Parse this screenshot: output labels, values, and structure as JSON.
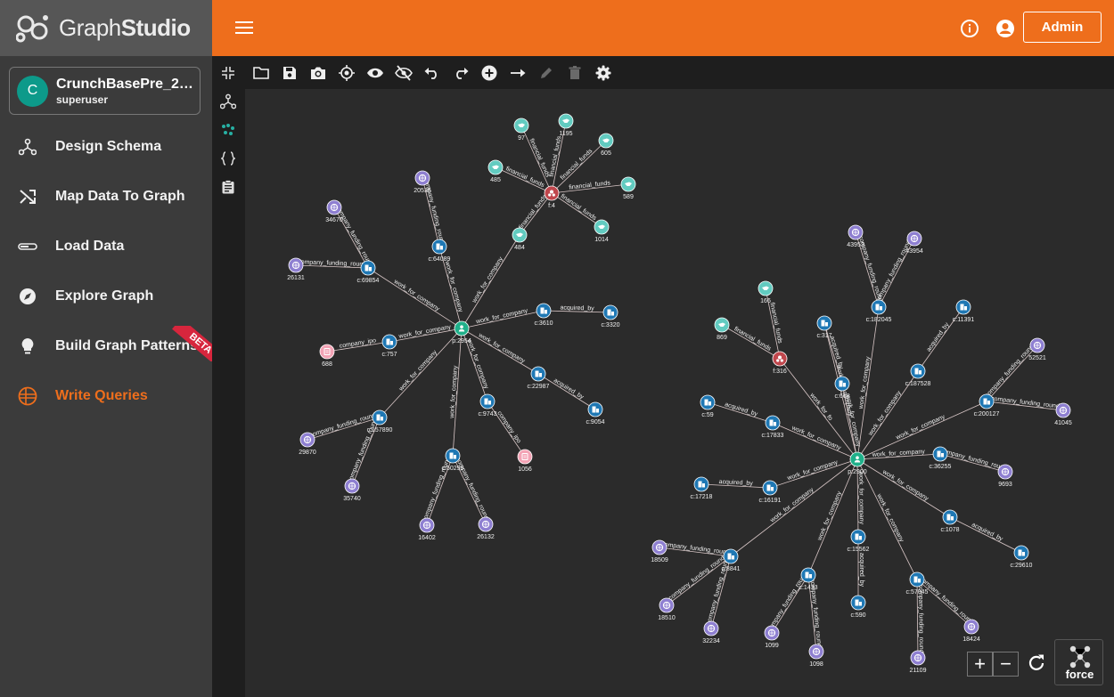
{
  "app": {
    "logo_regular": "Graph",
    "logo_bold": "Studio"
  },
  "graph_card": {
    "avatar_letter": "C",
    "name": "CrunchBasePre_20...",
    "role": "superuser"
  },
  "nav": [
    {
      "label": "Design Schema",
      "icon": "schema-icon"
    },
    {
      "label": "Map Data To Graph",
      "icon": "shuffle-icon"
    },
    {
      "label": "Load Data",
      "icon": "load-bar-icon"
    },
    {
      "label": "Explore Graph",
      "icon": "compass-icon"
    },
    {
      "label": "Build Graph Patterns",
      "icon": "lightbulb-icon",
      "badge": "BETA"
    },
    {
      "label": "Write Queries",
      "icon": "queries-icon",
      "active": true
    }
  ],
  "header": {
    "admin_label": "Admin"
  },
  "controls": {
    "zoom_in": "+",
    "zoom_out": "−",
    "layout_label": "force"
  },
  "colors": {
    "accent": "#ee6e1c",
    "person": "#20b08a",
    "company": "#1f78b4",
    "funding": "#8e7fd1",
    "investor": "#62cbc0",
    "ipo": "#f3a3b5",
    "financial_org": "#c0474d",
    "beta": "#d7263d"
  },
  "graph": {
    "nodes": [
      {
        "id": "p:2954",
        "label": "p:2954",
        "kind": "person"
      },
      {
        "id": "c:64089",
        "label": "c:64089",
        "kind": "company"
      },
      {
        "id": "c:69854",
        "label": "c:69854",
        "kind": "company"
      },
      {
        "id": "c:3610",
        "label": "c:3610",
        "kind": "company"
      },
      {
        "id": "c:3320",
        "label": "c:3320",
        "kind": "company"
      },
      {
        "id": "c:757",
        "label": "c:757",
        "kind": "company"
      },
      {
        "id": "c:22987",
        "label": "c:22987",
        "kind": "company"
      },
      {
        "id": "c:9054",
        "label": "c:9054",
        "kind": "company"
      },
      {
        "id": "c:9743",
        "label": "c:9743",
        "kind": "company"
      },
      {
        "id": "c:157890",
        "label": "c:157890",
        "kind": "company"
      },
      {
        "id": "c:50295",
        "label": "c:50295",
        "kind": "company"
      },
      {
        "id": "r:20535",
        "label": "20535",
        "kind": "funding"
      },
      {
        "id": "r:34670",
        "label": "34670",
        "kind": "funding"
      },
      {
        "id": "r:26131",
        "label": "26131",
        "kind": "funding"
      },
      {
        "id": "r:29870",
        "label": "29870",
        "kind": "funding"
      },
      {
        "id": "r:35740",
        "label": "35740",
        "kind": "funding"
      },
      {
        "id": "r:16402",
        "label": "16402",
        "kind": "funding"
      },
      {
        "id": "r:26132",
        "label": "26132",
        "kind": "funding"
      },
      {
        "id": "i:688",
        "label": "688",
        "kind": "ipo"
      },
      {
        "id": "i:1056",
        "label": "1056",
        "kind": "ipo"
      },
      {
        "id": "f:4",
        "label": "f:4",
        "kind": "financial_org"
      },
      {
        "id": "v:97",
        "label": "97",
        "kind": "investor"
      },
      {
        "id": "v:1195",
        "label": "1195",
        "kind": "investor"
      },
      {
        "id": "v:605",
        "label": "605",
        "kind": "investor"
      },
      {
        "id": "v:485",
        "label": "485",
        "kind": "investor"
      },
      {
        "id": "v:589",
        "label": "589",
        "kind": "investor"
      },
      {
        "id": "v:1014",
        "label": "1014",
        "kind": "investor"
      },
      {
        "id": "v:484",
        "label": "484",
        "kind": "investor"
      },
      {
        "id": "p:2900",
        "label": "p:2900",
        "kind": "person"
      },
      {
        "id": "f:316",
        "label": "f:316",
        "kind": "financial_org"
      },
      {
        "id": "v:166",
        "label": "166",
        "kind": "investor"
      },
      {
        "id": "v:869",
        "label": "869",
        "kind": "investor"
      },
      {
        "id": "c:317",
        "label": "c:317",
        "kind": "company"
      },
      {
        "id": "c:182045",
        "label": "c:182045",
        "kind": "company"
      },
      {
        "id": "r:43953",
        "label": "43953",
        "kind": "funding"
      },
      {
        "id": "r:43954",
        "label": "43954",
        "kind": "funding"
      },
      {
        "id": "c:11391",
        "label": "c:11391",
        "kind": "company"
      },
      {
        "id": "c:187528",
        "label": "c:187528",
        "kind": "company"
      },
      {
        "id": "c:668",
        "label": "c:668",
        "kind": "company"
      },
      {
        "id": "r:52521",
        "label": "52521",
        "kind": "funding"
      },
      {
        "id": "c:200127",
        "label": "c:200127",
        "kind": "company"
      },
      {
        "id": "r:41045",
        "label": "41045",
        "kind": "funding"
      },
      {
        "id": "c:59",
        "label": "c:59",
        "kind": "company"
      },
      {
        "id": "c:17833",
        "label": "c:17833",
        "kind": "company"
      },
      {
        "id": "c:36255",
        "label": "c:36255",
        "kind": "company"
      },
      {
        "id": "r:9693",
        "label": "9693",
        "kind": "funding"
      },
      {
        "id": "c:17218",
        "label": "c:17218",
        "kind": "company"
      },
      {
        "id": "c:16191",
        "label": "c:16191",
        "kind": "company"
      },
      {
        "id": "c:1078",
        "label": "c:1078",
        "kind": "company"
      },
      {
        "id": "c:29610",
        "label": "c:29610",
        "kind": "company"
      },
      {
        "id": "c:15562",
        "label": "c:15562",
        "kind": "company"
      },
      {
        "id": "r:18509",
        "label": "18509",
        "kind": "funding"
      },
      {
        "id": "c:8841",
        "label": "c:8841",
        "kind": "company"
      },
      {
        "id": "r:18510",
        "label": "18510",
        "kind": "funding"
      },
      {
        "id": "r:32234",
        "label": "32234",
        "kind": "funding"
      },
      {
        "id": "c:1433",
        "label": "c:1433",
        "kind": "company"
      },
      {
        "id": "r:1099",
        "label": "1099",
        "kind": "funding"
      },
      {
        "id": "r:1098",
        "label": "1098",
        "kind": "funding"
      },
      {
        "id": "c:590",
        "label": "c:590",
        "kind": "company"
      },
      {
        "id": "c:57045",
        "label": "c:57045",
        "kind": "company"
      },
      {
        "id": "r:18424",
        "label": "18424",
        "kind": "funding"
      },
      {
        "id": "r:21109",
        "label": "21109",
        "kind": "funding"
      }
    ],
    "edges": [
      {
        "from": "p:2954",
        "to": "c:64089",
        "label": "work_for_company"
      },
      {
        "from": "p:2954",
        "to": "c:69854",
        "label": "work_for_company"
      },
      {
        "from": "p:2954",
        "to": "c:3610",
        "label": "work_for_company"
      },
      {
        "from": "p:2954",
        "to": "c:757",
        "label": "work_for_company"
      },
      {
        "from": "p:2954",
        "to": "c:22987",
        "label": "work_for_company"
      },
      {
        "from": "p:2954",
        "to": "c:9743",
        "label": "work_for_company"
      },
      {
        "from": "p:2954",
        "to": "c:157890",
        "label": "work_for_company"
      },
      {
        "from": "p:2954",
        "to": "c:50295",
        "label": "work_for_company"
      },
      {
        "from": "p:2954",
        "to": "v:484",
        "label": "work_for_company"
      },
      {
        "from": "c:3610",
        "to": "c:3320",
        "label": "acquired_by"
      },
      {
        "from": "c:22987",
        "to": "c:9054",
        "label": "acquired_by"
      },
      {
        "from": "c:64089",
        "to": "r:20535",
        "label": "company_funding_round"
      },
      {
        "from": "c:69854",
        "to": "r:34670",
        "label": "company_funding_round"
      },
      {
        "from": "c:69854",
        "to": "r:26131",
        "label": "company_funding_round"
      },
      {
        "from": "c:157890",
        "to": "r:29870",
        "label": "company_funding_round"
      },
      {
        "from": "c:157890",
        "to": "r:35740",
        "label": "company_funding_round"
      },
      {
        "from": "c:50295",
        "to": "r:16402",
        "label": "company_funding_round"
      },
      {
        "from": "c:50295",
        "to": "r:26132",
        "label": "company_funding_round"
      },
      {
        "from": "c:757",
        "to": "i:688",
        "label": "company_ipo"
      },
      {
        "from": "c:9743",
        "to": "i:1056",
        "label": "company_ipo"
      },
      {
        "from": "f:4",
        "to": "v:97",
        "label": "financial_funds"
      },
      {
        "from": "f:4",
        "to": "v:1195",
        "label": "financial_funds"
      },
      {
        "from": "f:4",
        "to": "v:605",
        "label": "financial_funds"
      },
      {
        "from": "f:4",
        "to": "v:485",
        "label": "financial_funds"
      },
      {
        "from": "f:4",
        "to": "v:589",
        "label": "financial_funds"
      },
      {
        "from": "f:4",
        "to": "v:1014",
        "label": "financial_funds"
      },
      {
        "from": "f:4",
        "to": "v:484",
        "label": "financial_funds"
      },
      {
        "from": "p:2900",
        "to": "f:316",
        "label": "work_for_fo"
      },
      {
        "from": "p:2900",
        "to": "c:317",
        "label": "work_for_company"
      },
      {
        "from": "p:2900",
        "to": "c:182045",
        "label": "work_for_company"
      },
      {
        "from": "p:2900",
        "to": "c:187528",
        "label": "work_for_company"
      },
      {
        "from": "p:2900",
        "to": "c:668",
        "label": "work_for_company"
      },
      {
        "from": "p:2900",
        "to": "c:200127",
        "label": "work_for_company"
      },
      {
        "from": "p:2900",
        "to": "c:17833",
        "label": "work_for_company"
      },
      {
        "from": "p:2900",
        "to": "c:36255",
        "label": "work_for_company"
      },
      {
        "from": "p:2900",
        "to": "c:16191",
        "label": "work_for_company"
      },
      {
        "from": "p:2900",
        "to": "c:1078",
        "label": "work_for_company"
      },
      {
        "from": "p:2900",
        "to": "c:15562",
        "label": "work_for_company"
      },
      {
        "from": "p:2900",
        "to": "c:8841",
        "label": "work_for_company"
      },
      {
        "from": "p:2900",
        "to": "c:1433",
        "label": "work_for_company"
      },
      {
        "from": "p:2900",
        "to": "c:57045",
        "label": "work_for_company"
      },
      {
        "from": "f:316",
        "to": "v:166",
        "label": "financial_funds"
      },
      {
        "from": "f:316",
        "to": "v:869",
        "label": "financial_funds"
      },
      {
        "from": "c:317",
        "to": "c:668",
        "label": "acquired_by"
      },
      {
        "from": "c:182045",
        "to": "r:43953",
        "label": "company_funding_round"
      },
      {
        "from": "c:182045",
        "to": "r:43954",
        "label": "company_funding_round"
      },
      {
        "from": "c:187528",
        "to": "c:11391",
        "label": "acquired_by"
      },
      {
        "from": "c:200127",
        "to": "r:52521",
        "label": "company_funding_round"
      },
      {
        "from": "c:200127",
        "to": "r:41045",
        "label": "company_funding_round"
      },
      {
        "from": "c:17833",
        "to": "c:59",
        "label": "acquired_by"
      },
      {
        "from": "c:36255",
        "to": "r:9693",
        "label": "company_funding_round"
      },
      {
        "from": "c:16191",
        "to": "c:17218",
        "label": "acquired_by"
      },
      {
        "from": "c:1078",
        "to": "c:29610",
        "label": "acquired_by"
      },
      {
        "from": "c:15562",
        "to": "c:590",
        "label": "acquired_by"
      },
      {
        "from": "c:8841",
        "to": "r:18509",
        "label": "company_funding_round"
      },
      {
        "from": "c:8841",
        "to": "r:18510",
        "label": "company_funding_round"
      },
      {
        "from": "c:8841",
        "to": "r:32234",
        "label": "company_funding_round"
      },
      {
        "from": "c:1433",
        "to": "r:1099",
        "label": "company_funding_round"
      },
      {
        "from": "c:1433",
        "to": "r:1098",
        "label": "company_funding_round"
      },
      {
        "from": "c:57045",
        "to": "r:18424",
        "label": "company_funding_round"
      },
      {
        "from": "c:57045",
        "to": "r:21109",
        "label": "company_funding_round"
      }
    ]
  }
}
